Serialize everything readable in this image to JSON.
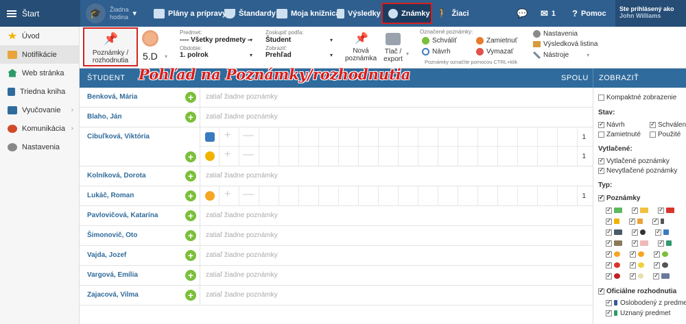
{
  "topbar": {
    "start": "Štart",
    "hodina_line1": "Žiadna",
    "hodina_line2": "hodina",
    "nav": [
      "Plány a prípravy",
      "Štandardy",
      "Moja knižnica",
      "Výsledky",
      "Známky",
      "Žiaci"
    ],
    "mail_count": "1",
    "help": "Pomoc",
    "user_line1": "Ste prihlásený ako",
    "user_line2": "John Williams"
  },
  "sidebar": {
    "items": [
      {
        "label": "Úvod",
        "icon": "star-icon",
        "color": "#f0b400"
      },
      {
        "label": "Notifikácie",
        "icon": "envelope-icon",
        "color": "#e8a33a"
      },
      {
        "label": "Web stránka",
        "icon": "home-icon",
        "color": "#2e9a6a"
      },
      {
        "label": "Triedna kniha",
        "icon": "book-icon",
        "color": "#2f6b9c"
      },
      {
        "label": "Vyučovanie",
        "icon": "books-icon",
        "color": "#2f6b9c"
      },
      {
        "label": "Komunikácia",
        "icon": "chat-icon",
        "color": "#d04a2a"
      },
      {
        "label": "Nastavenia",
        "icon": "gear-icon",
        "color": "#888888"
      }
    ]
  },
  "toolbar": {
    "notes_btn_line1": "Poznámky /",
    "notes_btn_line2": "rozhodnutia",
    "class": "5.D",
    "predmet_label": "Predmet:",
    "predmet_value": "---- Všetky predmety --",
    "obdobie_label": "Obdobie:",
    "obdobie_value": "1. polrok",
    "zoskupit_label": "Zoskupiť podľa:",
    "zoskupit_value": "Študent",
    "zobrazit_label": "Zobraziť:",
    "zobrazit_value": "Prehľad",
    "new_note_line1": "Nová",
    "new_note_line2": "poznámka",
    "print_line1": "Tlač /",
    "print_line2": "export",
    "marked_label": "Označené poznámky:",
    "approve": "Schváliť",
    "reject": "Zamietnuť",
    "draft": "Návrh",
    "delete": "Vymazať",
    "ctrl_hint": "Poznámky označíte pomocou CTRL+klik",
    "settings": "Nastavenia",
    "results_list": "Výsledková listina",
    "tools": "Nástroje"
  },
  "grid": {
    "col_student": "Študent",
    "col_total": "Spolu",
    "empty_text": "zatiaľ žiadne poznámky",
    "annotation": "Pohľad na Poznámky/rozhodnutia",
    "rows": [
      {
        "name": "Benková, Mária",
        "type": "empty"
      },
      {
        "name": "Blaho, Ján",
        "type": "empty"
      },
      {
        "name": "Cibuľková, Viktória",
        "type": "double",
        "count1": "1",
        "count2": "1"
      },
      {
        "name": "Kolníková, Dorota",
        "type": "empty"
      },
      {
        "name": "Lukáč, Roman",
        "type": "single",
        "count1": "1"
      },
      {
        "name": "Pavlovičová, Katarína",
        "type": "empty"
      },
      {
        "name": "Šimonovič, Oto",
        "type": "empty"
      },
      {
        "name": "Vajda, Jozef",
        "type": "empty"
      },
      {
        "name": "Vargová, Emília",
        "type": "empty"
      },
      {
        "name": "Zajacová, Vilma",
        "type": "empty"
      }
    ]
  },
  "right_panel": {
    "title": "Zobraziť",
    "compact": "Kompaktné zobrazenie",
    "stav_label": "Stav:",
    "navrh": "Návrh",
    "schvalene": "Schválené",
    "zamietnute": "Zamietnuté",
    "pouzite": "Použité",
    "vytlacene_label": "Vytlačené:",
    "vytlacene": "Vytlačené poznámky",
    "nevytlacene": "Nevytlačené poznámky",
    "typ_label": "Typ:",
    "poznamky": "Poznámky",
    "oficialne": "Oficiálne rozhodnutia",
    "oslobodeny": "Oslobodený z predmetu",
    "uznany": "Uznaný predmet"
  }
}
